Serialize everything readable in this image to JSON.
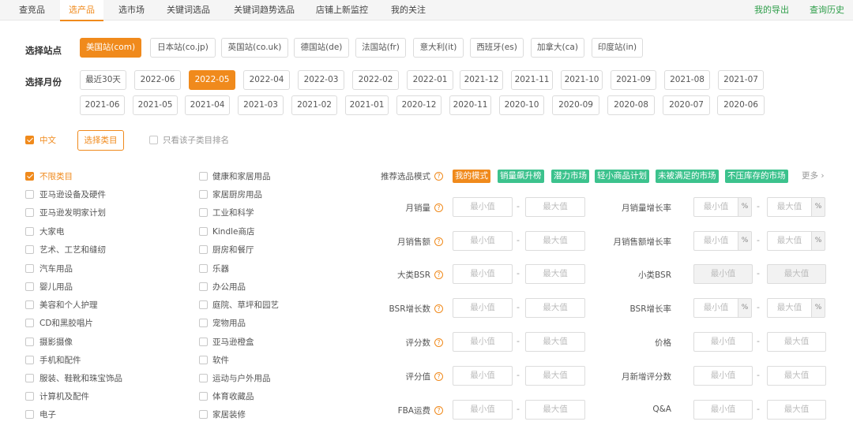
{
  "nav": {
    "tabs": [
      "查竞品",
      "选产品",
      "选市场",
      "关键词选品",
      "关键词趋势选品",
      "店铺上新监控",
      "我的关注"
    ],
    "active": 1,
    "export_label": "我的导出",
    "history_label": "查询历史"
  },
  "site": {
    "label": "选择站点",
    "options": [
      "美国站(com)",
      "日本站(co.jp)",
      "英国站(co.uk)",
      "德国站(de)",
      "法国站(fr)",
      "意大利(it)",
      "西班牙(es)",
      "加拿大(ca)",
      "印度站(in)"
    ],
    "selected": 0
  },
  "month": {
    "label": "选择月份",
    "row1": [
      "最近30天",
      "2022-06",
      "2022-05",
      "2022-04",
      "2022-03",
      "2022-02",
      "2022-01",
      "2021-12",
      "2021-11",
      "2021-10",
      "2021-09",
      "2021-08",
      "2021-07"
    ],
    "row2": [
      "2021-06",
      "2021-05",
      "2021-04",
      "2021-03",
      "2021-02",
      "2021-01",
      "2020-12",
      "2020-11",
      "2020-10",
      "2020-09",
      "2020-08",
      "2020-07",
      "2020-06"
    ],
    "selected": "2022-05"
  },
  "options": {
    "chinese_label": "中文",
    "select_category_label": "选择类目",
    "only_subcategory_label": "只看该子类目排名"
  },
  "categories_col1": [
    "不限类目",
    "亚马逊设备及硬件",
    "亚马逊发明家计划",
    "大家电",
    "艺术、工艺和缝纫",
    "汽车用品",
    "婴儿用品",
    "美容和个人护理",
    "CD和黑胶唱片",
    "摄影摄像",
    "手机和配件",
    "服装、鞋靴和珠宝饰品",
    "计算机及配件",
    "电子"
  ],
  "categories_col2": [
    "健康和家居用品",
    "家居厨房用品",
    "工业和科学",
    "Kindle商店",
    "厨房和餐厅",
    "乐器",
    "办公用品",
    "庭院、草坪和园艺",
    "宠物用品",
    "亚马逊橙盒",
    "软件",
    "运动与户外用品",
    "体育收藏品",
    "家居装修"
  ],
  "recommend": {
    "label": "推荐选品模式",
    "modes": [
      "我的模式",
      "销量飙升榜",
      "潜力市场",
      "轻小商品计划",
      "未被满足的市场",
      "不压库存的市场"
    ],
    "more_label": "更多"
  },
  "filters_left": [
    "月销量",
    "月销售额",
    "大类BSR",
    "BSR增长数",
    "评分数",
    "评分值",
    "FBA运费"
  ],
  "filters_right": [
    "月销量增长率",
    "月销售额增长率",
    "小类BSR",
    "BSR增长率",
    "价格",
    "月新增评分数",
    "Q&A"
  ],
  "placeholders": {
    "min": "最小值",
    "max": "最大值"
  },
  "pct_symbol": "%",
  "dash": "-",
  "help_symbol": "?",
  "colors": {
    "accent": "#f08a1c",
    "green": "#3cc28d",
    "nav_green": "#2e9e4a"
  }
}
